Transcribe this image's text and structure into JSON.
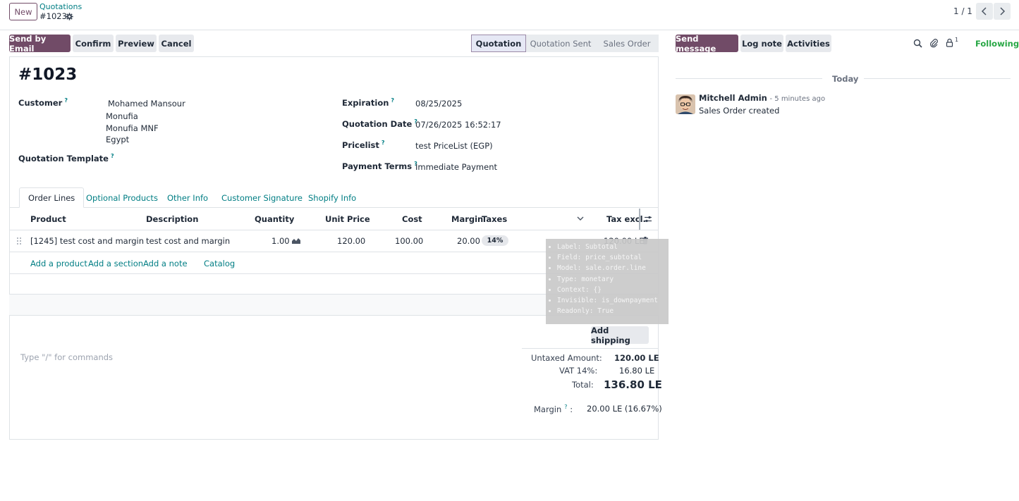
{
  "topbar": {
    "new_label": "New",
    "breadcrumb_parent": "Quotations",
    "breadcrumb_current": "#1023",
    "pager": "1 / 1"
  },
  "actions": {
    "send_email": "Send by Email",
    "confirm": "Confirm",
    "preview": "Preview",
    "cancel": "Cancel"
  },
  "statusbar": [
    "Quotation",
    "Quotation Sent",
    "Sales Order"
  ],
  "form": {
    "title": "#1023",
    "customer_label": "Customer",
    "customer_name": "Mohamed Mansour",
    "customer_address": [
      "Monufia",
      "Monufia MNF",
      "Egypt"
    ],
    "template_label": "Quotation Template",
    "expiration_label": "Expiration",
    "expiration": "08/25/2025",
    "quotation_date_label": "Quotation Date",
    "quotation_date": "07/26/2025 16:52:17",
    "pricelist_label": "Pricelist",
    "pricelist": "test PriceList (EGP)",
    "payment_terms_label": "Payment Terms",
    "payment_terms": "Immediate Payment",
    "help_mark": "?"
  },
  "tabs": [
    "Order Lines",
    "Optional Products",
    "Other Info",
    "Customer Signature",
    "Shopify Info"
  ],
  "table": {
    "headers": {
      "product": "Product",
      "description": "Description",
      "quantity": "Quantity",
      "unit_price": "Unit Price",
      "cost": "Cost",
      "margin": "Margin",
      "taxes": "Taxes",
      "tax_excl": "Tax excl."
    },
    "row": {
      "product": "[1245] test cost and margin",
      "description": "test cost and margin",
      "quantity": "1.00",
      "unit_price": "120.00",
      "cost": "100.00",
      "margin": "20.00",
      "tax": "14%",
      "subtotal": "120.00 LE"
    },
    "add_product": "Add a product",
    "add_section": "Add a section",
    "add_note": "Add a note",
    "catalog": "Catalog"
  },
  "tooltip": [
    {
      "k": "Label:",
      "v": "Subtotal"
    },
    {
      "k": "Field:",
      "v": "price_subtotal"
    },
    {
      "k": "Model:",
      "v": "sale.order.line"
    },
    {
      "k": "Type:",
      "v": "monetary"
    },
    {
      "k": "Context:",
      "v": "{}"
    },
    {
      "k": "Invisible:",
      "v": "is_downpayment"
    },
    {
      "k": "Readonly:",
      "v": "True"
    }
  ],
  "add_shipping": "Add shipping",
  "note_placeholder": "Type \"/\" for commands",
  "totals": {
    "untaxed_label": "Untaxed Amount:",
    "untaxed": "120.00 LE",
    "vat_label": "VAT 14%:",
    "vat": "16.80 LE",
    "total_label": "Total:",
    "total": "136.80 LE",
    "margin_label": "Margin",
    "margin_colon": ":",
    "margin": "20.00 LE (16.67%)"
  },
  "chatter": {
    "send_message": "Send message",
    "log_note": "Log note",
    "activities": "Activities",
    "follower_count": "1",
    "following": "Following",
    "day": "Today",
    "author": "Mitchell Admin",
    "time": "- 5 minutes ago",
    "message": "Sales Order created"
  },
  "colors": {
    "primary": "#714b67",
    "link": "#017e84",
    "following": "#28a745"
  }
}
